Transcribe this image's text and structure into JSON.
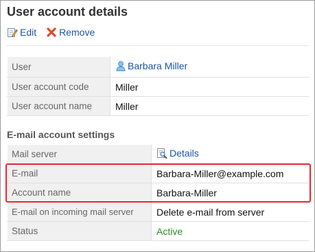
{
  "page": {
    "title": "User account details"
  },
  "toolbar": {
    "edit_label": "Edit",
    "remove_label": "Remove"
  },
  "user_section": {
    "rows": [
      {
        "label": "User",
        "value": "Barbara Miller",
        "icon": "user-icon",
        "link": true
      },
      {
        "label": "User account code",
        "value": "Miller"
      },
      {
        "label": "User account name",
        "value": "Miller"
      }
    ]
  },
  "email_section": {
    "title": "E-mail account settings",
    "rows": [
      {
        "label": "Mail server",
        "value": "Details",
        "icon": "magnifier-details-icon",
        "link": true
      },
      {
        "label": "E-mail",
        "value": "Barbara-Miller@example.com"
      },
      {
        "label": "Account name",
        "value": "Barbara-Miller"
      },
      {
        "label": "E-mail on incoming mail server",
        "value": "Delete e-mail from server"
      },
      {
        "label": "Status",
        "value": "Active"
      }
    ]
  },
  "colors": {
    "link": "#1a54a8",
    "highlight_border": "#e8262d",
    "status_active": "#2a8a2a",
    "label_bg": "#f0f0f0"
  }
}
